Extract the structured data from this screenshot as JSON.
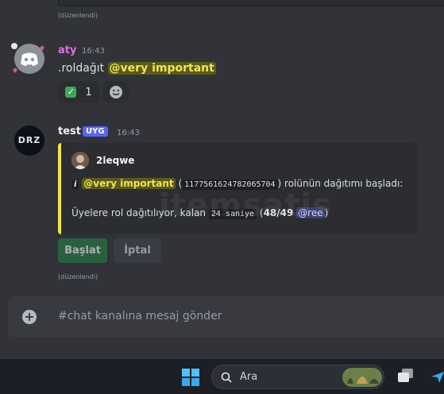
{
  "previous": {
    "edited_label": "(düzenlendi)"
  },
  "message1": {
    "author": "aty",
    "time": "16:43",
    "command": ".roldağıt",
    "mention": "@very important",
    "reaction_count": "1",
    "reaction_icon": "check-mark-emoji",
    "add_reaction_icon": "smiley-icon"
  },
  "message2": {
    "author": "test",
    "badge": "UYG",
    "time": "16:43",
    "avatar_text": "DRZ",
    "embed": {
      "author": "2leqwe",
      "info_icon": "i",
      "mention": "@very important",
      "role_id": "1177561624782065704",
      "line1_open": "(",
      "line1_close": ") rolünün dağıtımı başladı:",
      "line2_prefix": "Üyelere rol dağıtılıyor, kalan",
      "remaining": "24 saniye",
      "progress_open": "(",
      "progress": "48/49",
      "target": "@ree",
      "progress_close": ")",
      "accent_color": "#f0e64a"
    },
    "buttons": {
      "start": "Başlat",
      "cancel": "İptal"
    },
    "edited_label": "(düzenlendi)"
  },
  "input": {
    "placeholder": "#chat kanalına mesaj gönder"
  },
  "taskbar": {
    "search_placeholder": "Ara"
  },
  "watermark": "itemsatis"
}
